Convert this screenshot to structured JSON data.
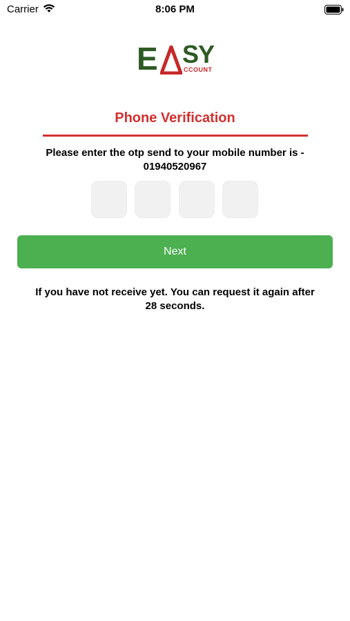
{
  "status_bar": {
    "carrier": "Carrier",
    "time": "8:06 PM",
    "wifi_icon": "wifi-icon",
    "battery_icon": "battery-icon"
  },
  "logo": {
    "letter_e": "E",
    "letters_sy": "SY",
    "subtitle": "CCOUNT",
    "colors": {
      "green": "#2e5a24",
      "red": "#c62828"
    }
  },
  "verification": {
    "title": "Phone Verification",
    "instruction_line1": "Please enter the otp send to your mobile number is -",
    "phone_number": "01940520967",
    "otp_boxes": [
      "",
      "",
      "",
      ""
    ]
  },
  "actions": {
    "next_label": "Next"
  },
  "resend": {
    "line1": "If you have not receive yet. You can request it again after",
    "line2": "28 seconds."
  },
  "colors": {
    "accent_red": "#d32f2f",
    "button_green": "#4caf50",
    "otp_box_bg": "#f1f1f1"
  }
}
